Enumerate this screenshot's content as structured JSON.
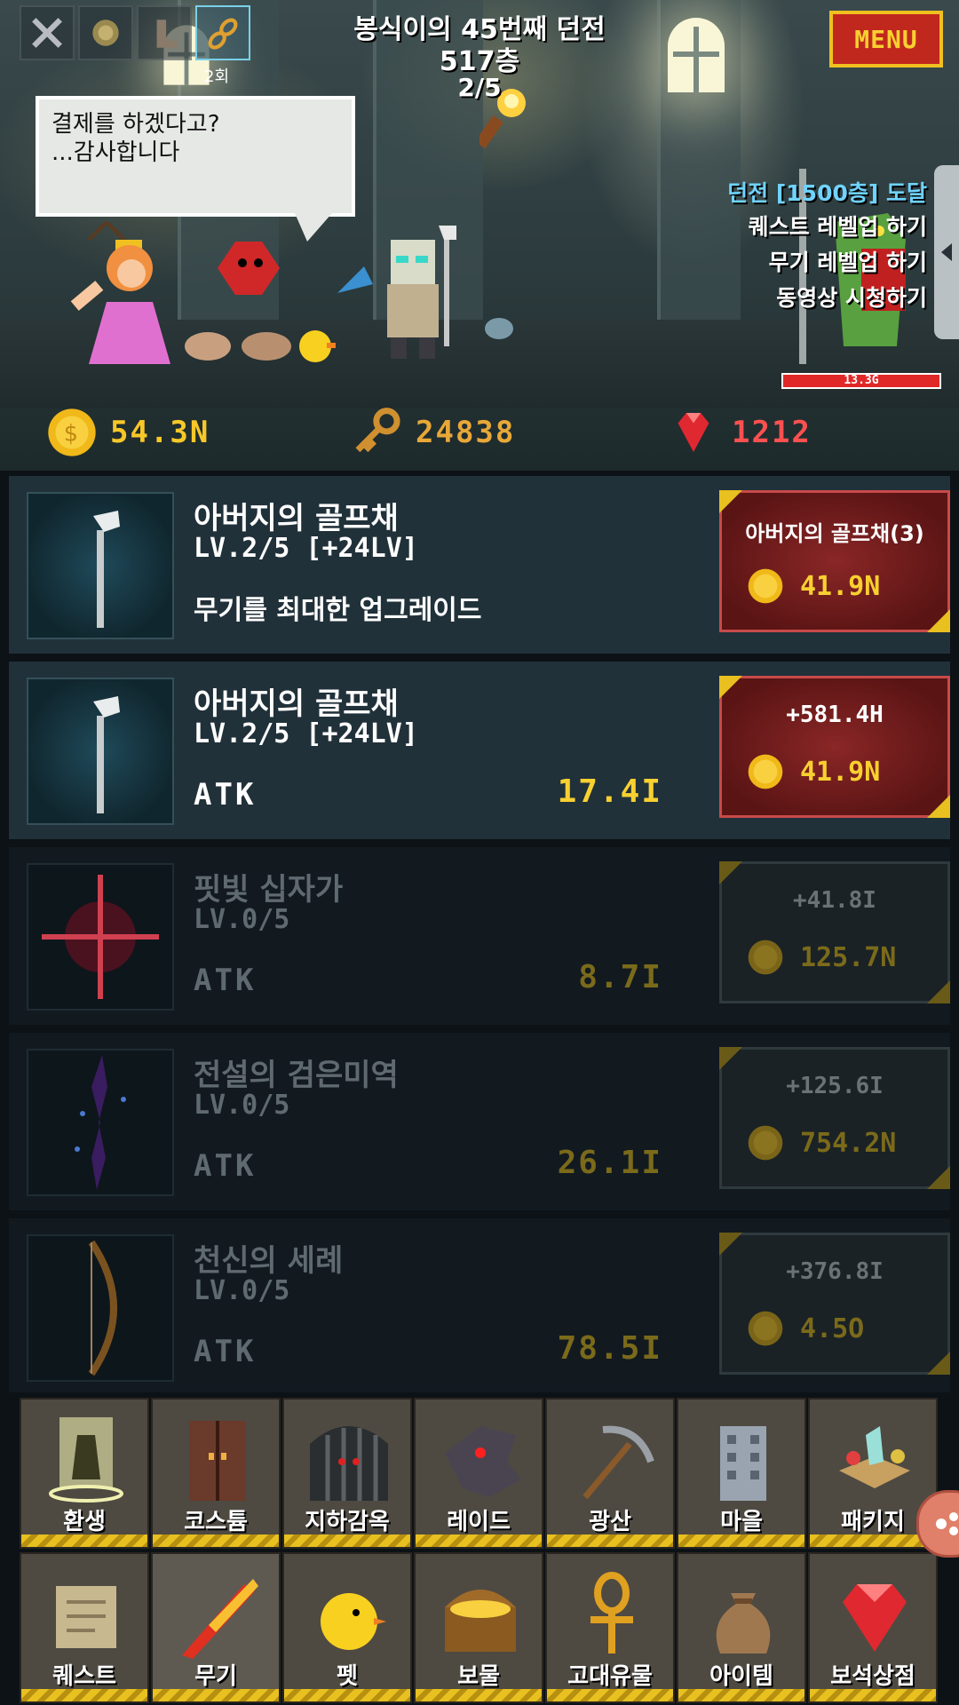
{
  "header": {
    "dungeon_title": "봉식이의 45번째 던전",
    "floor": "517층",
    "wave": "2/5",
    "menu_label": "MENU",
    "skill_count": "2회",
    "skills": [
      "sword-skill-icon",
      "coin-skill-icon",
      "boot-skill-icon",
      "chain-skill-icon"
    ]
  },
  "speech": {
    "line1": "결제를 하겠다고?",
    "line2": "...감사합니다"
  },
  "quests": {
    "goal": "던전 [1500층] 도달",
    "quest_levelup": "퀘스트 레벨업 하기",
    "weapon_levelup": "무기 레벨업 하기",
    "watch_video": "동영상 시청하기",
    "goal_color": "#6fd3ff"
  },
  "enemy": {
    "hp": "13.3G"
  },
  "currency": {
    "gold": "54.3N",
    "keys": "24838",
    "gems": "1212",
    "gold_color": "#f8c828",
    "key_color": "#e8a838",
    "gem_color": "#ff5050"
  },
  "items": [
    {
      "name": "아버지의 골프채",
      "level": "LV.2/5 [+24LV]",
      "desc": "무기를 최대한 업그레이드",
      "buy_top": "아버지의 골프채(3)",
      "cost": "41.9N"
    },
    {
      "name": "아버지의 골프채",
      "level": "LV.2/5 [+24LV]",
      "atk_label": "ATK",
      "atk": "17.4I",
      "buy_top": "+581.4H",
      "cost": "41.9N"
    },
    {
      "name": "핏빛 십자가",
      "level": "LV.0/5",
      "atk_label": "ATK",
      "atk": "8.7I",
      "buy_top": "+41.8I",
      "cost": "125.7N"
    },
    {
      "name": "전설의 검은미역",
      "level": "LV.0/5",
      "atk_label": "ATK",
      "atk": "26.1I",
      "buy_top": "+125.6I",
      "cost": "754.2N"
    },
    {
      "name": "천신의 세례",
      "level": "LV.0/5",
      "atk_label": "ATK",
      "atk": "78.5I",
      "buy_top": "+376.8I",
      "cost": "4.5O"
    }
  ],
  "nav": {
    "row1": [
      "환생",
      "코스튬",
      "지하감옥",
      "레이드",
      "광산",
      "마을",
      "패키지"
    ],
    "row2": [
      "퀘스트",
      "무기",
      "펫",
      "보물",
      "고대유물",
      "아이템",
      "보석상점"
    ],
    "selected": "무기"
  }
}
